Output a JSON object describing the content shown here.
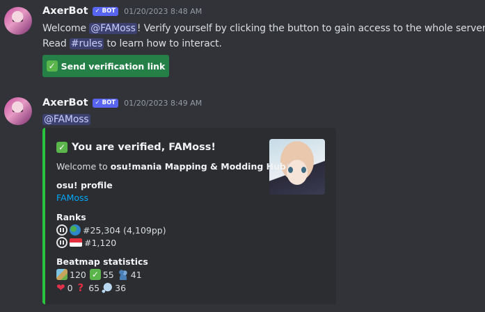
{
  "message1": {
    "username": "AxerBot",
    "bot_tag": "✓ BOT",
    "timestamp": "01/20/2023 8:48 AM",
    "line1_prefix": "Welcome ",
    "line1_mention": "@FAMoss",
    "line1_suffix": "! Verify yourself by clicking the button to gain access to the whole server!",
    "line2_prefix": "Read ",
    "line2_channel": "#rules",
    "line2_suffix": " to learn how to interact.",
    "button_label": "Send verification link",
    "button_icon": "✓"
  },
  "message2": {
    "username": "AxerBot",
    "bot_tag": "✓ BOT",
    "timestamp": "01/20/2023 8:49 AM",
    "mention": "@FAMoss",
    "embed": {
      "accent_color": "#2ac33d",
      "title_icon": "✓",
      "title": "You are verified, FAMoss!",
      "desc_prefix": "Welcome to ",
      "desc_bold": "osu!mania Mapping & Modding Hub",
      "desc_suffix": "!",
      "profile_field_name": "osu! profile",
      "profile_link": "FAMoss",
      "ranks_field_name": "Ranks",
      "global_rank": "#25,304 (4,109pp)",
      "country_rank": "#1,120",
      "beatmap_field_name": "Beatmap statistics",
      "ranked": "120",
      "loved": "55",
      "guest": "41",
      "favourites": "0",
      "pending": "65",
      "graveyard": "36"
    }
  },
  "colors": {
    "background": "#313338",
    "button": "#248046",
    "mention_bg": "rgba(88,101,242,0.3)",
    "link": "#00a8fc",
    "bot_tag": "#5865f2"
  }
}
